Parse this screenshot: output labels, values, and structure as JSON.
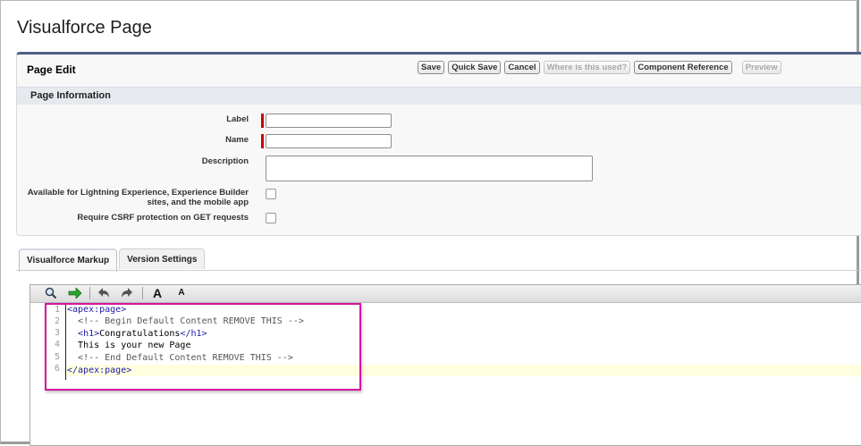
{
  "page": {
    "title": "Visualforce Page"
  },
  "page_edit": {
    "title": "Page Edit",
    "buttons": {
      "save": "Save",
      "quick_save": "Quick Save",
      "cancel": "Cancel",
      "where_used": "Where is this used?",
      "component_reference": "Component Reference",
      "preview": "Preview"
    }
  },
  "page_information": {
    "title": "Page Information",
    "label_label": "Label",
    "label_value": "",
    "name_label": "Name",
    "name_value": "",
    "description_label": "Description",
    "description_value": "",
    "lightning_line1": "Available for Lightning Experience, Experience Builder",
    "lightning_line2": "sites, and the mobile app",
    "csrf_label": "Require CSRF protection on GET requests",
    "lightning_checked": false,
    "csrf_checked": false
  },
  "tabs": [
    {
      "label": "Visualforce Markup",
      "active": true
    },
    {
      "label": "Version Settings",
      "active": false
    }
  ],
  "toolbar": {
    "icons": [
      "search-icon",
      "go-to-line-arrow-icon",
      "undo-icon",
      "redo-icon",
      "increase-font-icon",
      "decrease-font-icon"
    ],
    "font_large": "A",
    "font_small": "A"
  },
  "editor": {
    "line_numbers": [
      "1",
      "2",
      "3",
      "4",
      "5",
      "6"
    ],
    "lines": [
      {
        "tag_open": "<apex:page>",
        "text": "",
        "tag_close": ""
      },
      {
        "comment": "<!-- Begin Default Content REMOVE THIS -->"
      },
      {
        "tag_open": "<h1>",
        "text": "Congratulations",
        "tag_close": "</h1>"
      },
      {
        "plain": "This is your new Page"
      },
      {
        "comment": "<!-- End Default Content REMOVE THIS -->"
      },
      {
        "tag_open": "</apex:page>",
        "text": "",
        "tag_close": ""
      }
    ],
    "colors": {
      "tag": "#1a1aa6",
      "comment": "#555555",
      "active_line": "#ffffe0",
      "highlight_box": "#d4169e"
    }
  }
}
